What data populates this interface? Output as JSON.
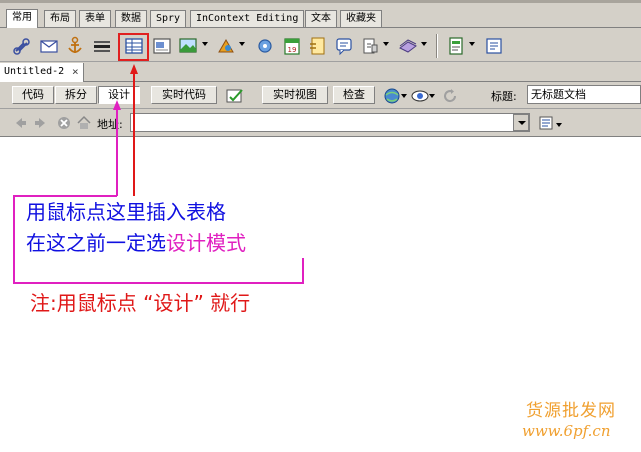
{
  "insert_bar": {
    "tabs": [
      "常用",
      "布局",
      "表单",
      "数据",
      "Spry",
      "InContext Editing",
      "文本",
      "收藏夹"
    ],
    "active_tab": "常用",
    "tooltip": "表格"
  },
  "document": {
    "tab_title": "Untitled-2",
    "tab_close": "×"
  },
  "doc_toolbar": {
    "code": "代码",
    "split": "拆分",
    "design": "设计",
    "live_code": "实时代码",
    "live_view": "实时视图",
    "inspect": "检查",
    "title_label": "标题:",
    "title_value": "无标题文档"
  },
  "address_bar": {
    "label": "地址:",
    "value": ""
  },
  "annotations": {
    "line1": "用鼠标点这里插入表格",
    "line2a": "在这之前一定选",
    "line2b": "设计模式",
    "line3": "注:用鼠标点 “设计” 就行"
  },
  "watermark": {
    "line1": "货源批发网",
    "line2": "www.6pf.cn"
  },
  "colors": {
    "annotation_blue": "#1010e0",
    "annotation_magenta": "#e020c0",
    "annotation_red": "#e01818",
    "watermark": "#f0a030"
  }
}
